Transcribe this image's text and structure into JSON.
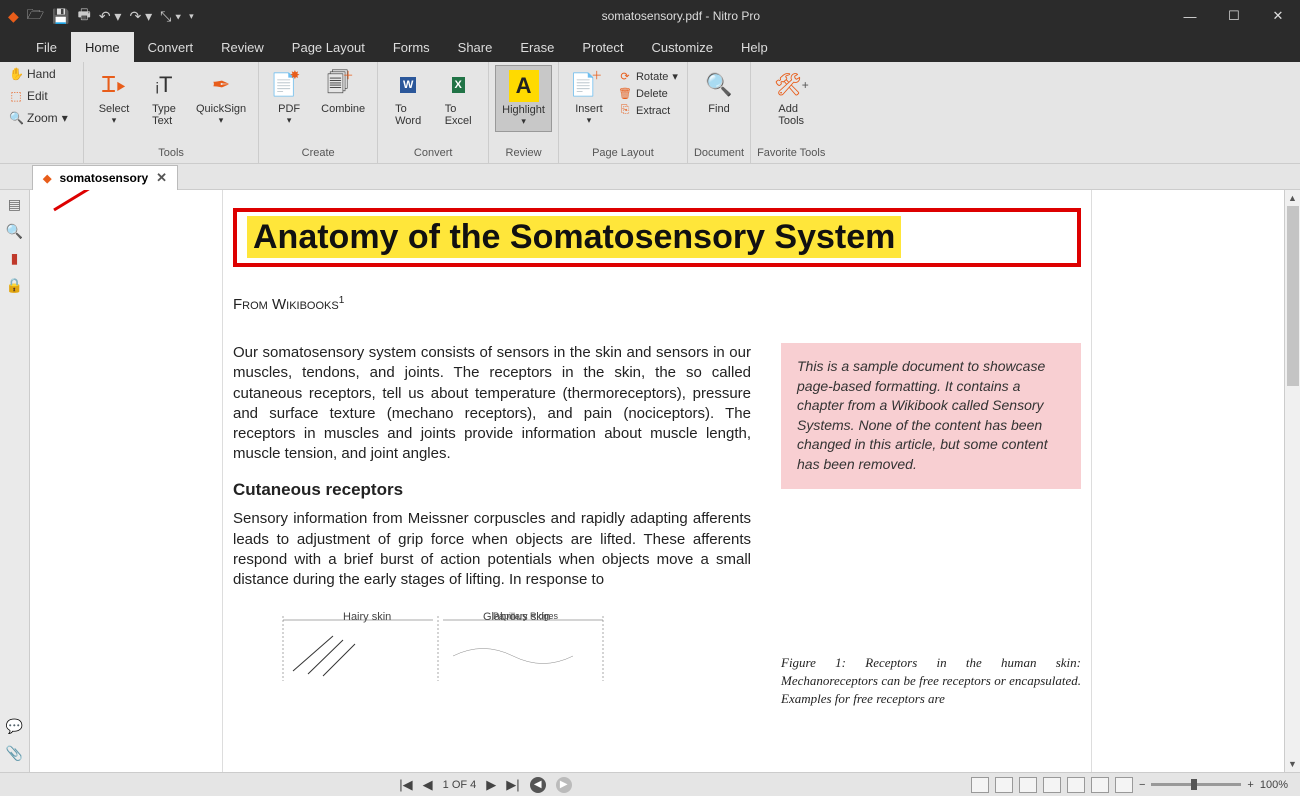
{
  "app": {
    "title": "somatosensory.pdf - Nitro Pro"
  },
  "qat": [
    "nitro",
    "open",
    "save",
    "print",
    "undo",
    "undo-more",
    "redo",
    "redo-more",
    "select-tool",
    "more"
  ],
  "menu": {
    "items": [
      "File",
      "Home",
      "Convert",
      "Review",
      "Page Layout",
      "Forms",
      "Share",
      "Erase",
      "Protect",
      "Customize",
      "Help"
    ],
    "active": 1
  },
  "leftTools": {
    "hand": "Hand",
    "edit": "Edit",
    "zoom": "Zoom"
  },
  "ribbon": {
    "tools": {
      "label": "Tools",
      "select": "Select",
      "typetext": "Type\nText",
      "quicksign": "QuickSign"
    },
    "create": {
      "label": "Create",
      "pdf": "PDF",
      "combine": "Combine"
    },
    "convert": {
      "label": "Convert",
      "toword": "To\nWord",
      "toexcel": "To\nExcel"
    },
    "review": {
      "label": "Review",
      "highlight": "Highlight"
    },
    "pagelayout": {
      "label": "Page Layout",
      "insert": "Insert",
      "rotate": "Rotate",
      "del": "Delete",
      "extract": "Extract"
    },
    "document": {
      "label": "Document",
      "find": "Find"
    },
    "fav": {
      "label": "Favorite Tools",
      "add": "Add\nTools"
    }
  },
  "tab": {
    "name": "somatosensory"
  },
  "doc": {
    "title": "Anatomy of the Somatosensory System",
    "subhead": "From Wikibooks",
    "sup": "1",
    "para1": "Our somatosensory system consists of sensors in the skin and sensors in our muscles, tendons, and joints. The receptors in the skin, the so called cutaneous receptors, tell us about temperature (thermoreceptors), pressure and surface texture (mechano receptors), and pain (nociceptors). The receptors in muscles and joints provide information about muscle length, muscle tension, and joint angles.",
    "h2": "Cutaneous receptors",
    "para2": "Sensory information from Meissner corpuscles and rapidly adapting afferents leads to adjustment of grip force when objects are lifted. These afferents respond with a brief burst of action potentials when objects move a small distance during the early stages of lifting. In response to",
    "note": "This is a sample document to showcase page-based formatting. It contains a chapter from a Wikibook called Sensory Systems. None of the content has been changed in this article, but some content has been removed.",
    "figcap": "Figure 1:  Receptors in the human skin: Mechanoreceptors can be free receptors or encapsulated. Examples  for  free  receptors  are",
    "diag": {
      "hairy": "Hairy skin",
      "glab": "Glabrous skin",
      "pap": "Papillary Ridges"
    }
  },
  "status": {
    "page": "1 OF 4",
    "zoom": "100%"
  }
}
